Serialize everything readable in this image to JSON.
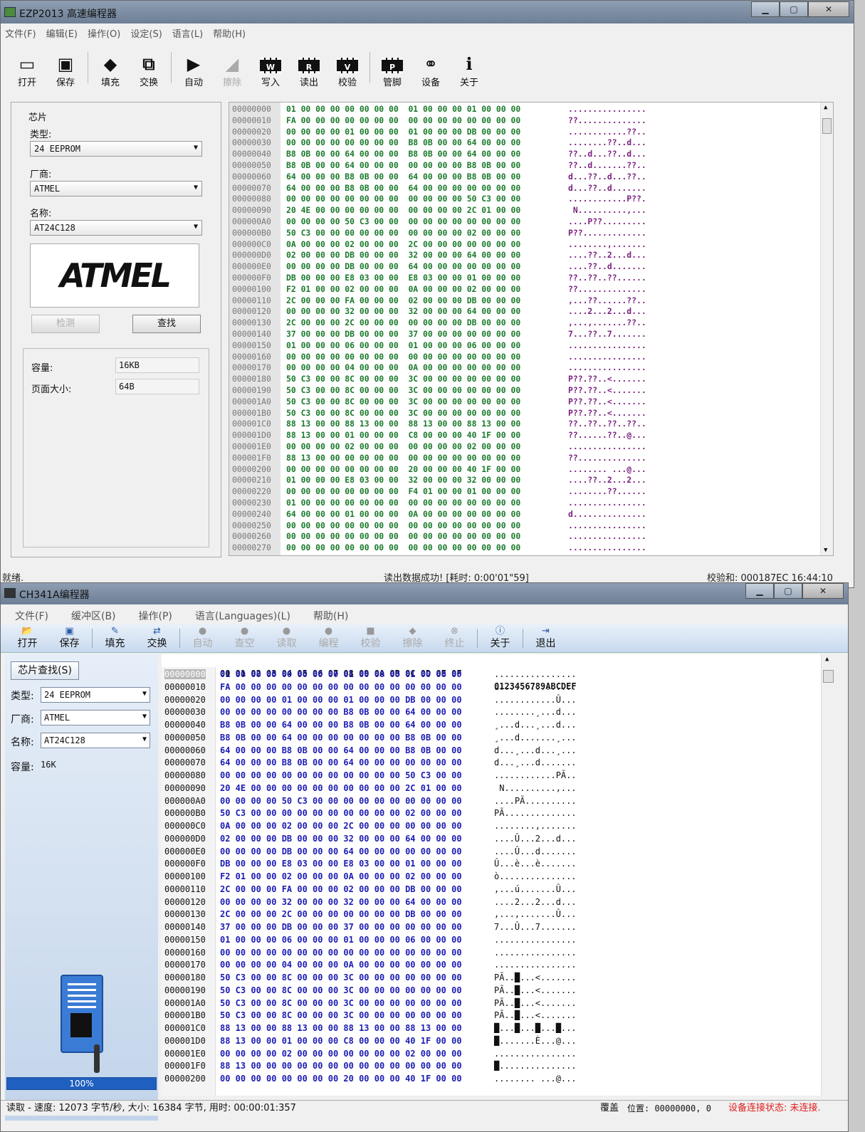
{
  "win1": {
    "title": "EZP2013 高速编程器",
    "menu": [
      "文件(F)",
      "编辑(E)",
      "操作(O)",
      "设定(S)",
      "语言(L)",
      "帮助(H)"
    ],
    "toolbar": [
      {
        "label": "打开",
        "icon": "open-icon",
        "enabled": true
      },
      {
        "label": "保存",
        "icon": "save-icon",
        "enabled": true
      },
      {
        "label": "填充",
        "icon": "fill-icon",
        "enabled": true
      },
      {
        "label": "交换",
        "icon": "swap-icon",
        "enabled": true
      },
      {
        "label": "自动",
        "icon": "auto-icon",
        "enabled": true
      },
      {
        "label": "擦除",
        "icon": "erase-icon",
        "enabled": false
      },
      {
        "label": "写入",
        "icon": "write-icon",
        "chip": "W",
        "enabled": true
      },
      {
        "label": "读出",
        "icon": "read-icon",
        "chip": "R",
        "enabled": true
      },
      {
        "label": "校验",
        "icon": "verify-icon",
        "chip": "V",
        "enabled": true
      },
      {
        "label": "管脚",
        "icon": "pin-icon",
        "chip": "P",
        "enabled": true
      },
      {
        "label": "设备",
        "icon": "device-icon",
        "enabled": true
      },
      {
        "label": "关于",
        "icon": "about-icon",
        "enabled": true
      }
    ],
    "chip": {
      "group_label": "芯片",
      "type_label": "类型:",
      "type_value": "24 EEPROM",
      "vendor_label": "厂商:",
      "vendor_value": "ATMEL",
      "name_label": "名称:",
      "name_value": "AT24C128",
      "logo_text": "ATMEL",
      "detect_button": "检测",
      "find_button": "查找",
      "capacity_label": "容量:",
      "capacity_value": "16KB",
      "page_label": "页面大小:",
      "page_value": "64B"
    },
    "hex_rows": [
      [
        "00000000",
        "01 00 00 00 00 00 00 00  01 00 00 00 01 00 00 00",
        "................"
      ],
      [
        "00000010",
        "FA 00 00 00 00 00 00 00  00 00 00 00 00 00 00 00",
        "??.............."
      ],
      [
        "00000020",
        "00 00 00 00 01 00 00 00  01 00 00 00 DB 00 00 00",
        "............??.."
      ],
      [
        "00000030",
        "00 00 00 00 00 00 00 00  B8 0B 00 00 64 00 00 00",
        "........??..d..."
      ],
      [
        "00000040",
        "B8 0B 00 00 64 00 00 00  B8 0B 00 00 64 00 00 00",
        "??..d...??..d..."
      ],
      [
        "00000050",
        "B8 0B 00 00 64 00 00 00  00 00 00 00 B8 0B 00 00",
        "??..d.......??.."
      ],
      [
        "00000060",
        "64 00 00 00 B8 0B 00 00  64 00 00 00 B8 0B 00 00",
        "d...??..d...??.."
      ],
      [
        "00000070",
        "64 00 00 00 B8 0B 00 00  64 00 00 00 00 00 00 00",
        "d...??..d......."
      ],
      [
        "00000080",
        "00 00 00 00 00 00 00 00  00 00 00 00 50 C3 00 00",
        "............P??."
      ],
      [
        "00000090",
        "20 4E 00 00 00 00 00 00  00 00 00 00 2C 01 00 00",
        " N..........,..."
      ],
      [
        "000000A0",
        "00 00 00 00 50 C3 00 00  00 00 00 00 00 00 00 00",
        "....P??........."
      ],
      [
        "000000B0",
        "50 C3 00 00 00 00 00 00  00 00 00 00 02 00 00 00",
        "P??............."
      ],
      [
        "000000C0",
        "0A 00 00 00 02 00 00 00  2C 00 00 00 00 00 00 00",
        "........,......."
      ],
      [
        "000000D0",
        "02 00 00 00 DB 00 00 00  32 00 00 00 64 00 00 00",
        "....??..2...d..."
      ],
      [
        "000000E0",
        "00 00 00 00 DB 00 00 00  64 00 00 00 00 00 00 00",
        "....??..d......."
      ],
      [
        "000000F0",
        "DB 00 00 00 E8 03 00 00  E8 03 00 00 01 00 00 00",
        "??..??..??......"
      ],
      [
        "00000100",
        "F2 01 00 00 02 00 00 00  0A 00 00 00 02 00 00 00",
        "??.............."
      ],
      [
        "00000110",
        "2C 00 00 00 FA 00 00 00  02 00 00 00 DB 00 00 00",
        ",...??......??.."
      ],
      [
        "00000120",
        "00 00 00 00 32 00 00 00  32 00 00 00 64 00 00 00",
        "....2...2...d..."
      ],
      [
        "00000130",
        "2C 00 00 00 2C 00 00 00  00 00 00 00 DB 00 00 00",
        ",...,.......??.."
      ],
      [
        "00000140",
        "37 00 00 00 DB 00 00 00  37 00 00 00 00 00 00 00",
        "7...??..7......."
      ],
      [
        "00000150",
        "01 00 00 00 06 00 00 00  01 00 00 00 06 00 00 00",
        "................"
      ],
      [
        "00000160",
        "00 00 00 00 00 00 00 00  00 00 00 00 00 00 00 00",
        "................"
      ],
      [
        "00000170",
        "00 00 00 00 04 00 00 00  0A 00 00 00 00 00 00 00",
        "................"
      ],
      [
        "00000180",
        "50 C3 00 00 8C 00 00 00  3C 00 00 00 00 00 00 00",
        "P??.??..<......."
      ],
      [
        "00000190",
        "50 C3 00 00 8C 00 00 00  3C 00 00 00 00 00 00 00",
        "P??.??..<......."
      ],
      [
        "000001A0",
        "50 C3 00 00 8C 00 00 00  3C 00 00 00 00 00 00 00",
        "P??.??..<......."
      ],
      [
        "000001B0",
        "50 C3 00 00 8C 00 00 00  3C 00 00 00 00 00 00 00",
        "P??.??..<......."
      ],
      [
        "000001C0",
        "88 13 00 00 88 13 00 00  88 13 00 00 88 13 00 00",
        "??..??..??..??.."
      ],
      [
        "000001D0",
        "88 13 00 00 01 00 00 00  C8 00 00 00 40 1F 00 00",
        "??......??..@..."
      ],
      [
        "000001E0",
        "00 00 00 00 02 00 00 00  00 00 00 00 02 00 00 00",
        "................"
      ],
      [
        "000001F0",
        "88 13 00 00 00 00 00 00  00 00 00 00 00 00 00 00",
        "??.............."
      ],
      [
        "00000200",
        "00 00 00 00 00 00 00 00  20 00 00 00 40 1F 00 00",
        "........ ...@..."
      ],
      [
        "00000210",
        "01 00 00 00 E8 03 00 00  32 00 00 00 32 00 00 00",
        "....??..2...2..."
      ],
      [
        "00000220",
        "00 00 00 00 00 00 00 00  F4 01 00 00 01 00 00 00",
        "........??......"
      ],
      [
        "00000230",
        "01 00 00 00 00 00 00 00  00 00 00 00 00 00 00 00",
        "................"
      ],
      [
        "00000240",
        "64 00 00 00 01 00 00 00  0A 00 00 00 00 00 00 00",
        "d..............."
      ],
      [
        "00000250",
        "00 00 00 00 00 00 00 00  00 00 00 00 00 00 00 00",
        "................"
      ],
      [
        "00000260",
        "00 00 00 00 00 00 00 00  00 00 00 00 00 00 00 00",
        "................"
      ],
      [
        "00000270",
        "00 00 00 00 00 00 00 00  00 00 00 00 00 00 00 00",
        "................"
      ]
    ],
    "status": {
      "left": "就绪.",
      "middle": "读出数据成功! [耗时: 0:00'01\"59]",
      "right": "校验和: 000187EC 16:44:10"
    }
  },
  "win2": {
    "title": "CH341A编程器",
    "menu": [
      "文件(F)",
      "缓冲区(B)",
      "操作(P)",
      "语言(Languages)(L)",
      "帮助(H)"
    ],
    "toolbar": [
      {
        "label": "打开",
        "icon": "open-icon",
        "enabled": true
      },
      {
        "label": "保存",
        "icon": "save-icon",
        "enabled": true
      },
      {
        "label": "填充",
        "icon": "fill-icon",
        "enabled": true
      },
      {
        "label": "交换",
        "icon": "swap-icon",
        "enabled": true
      },
      {
        "label": "自动",
        "icon": "auto-icon",
        "enabled": false
      },
      {
        "label": "查空",
        "icon": "blank-check-icon",
        "enabled": false
      },
      {
        "label": "读取",
        "icon": "read-icon",
        "enabled": false
      },
      {
        "label": "编程",
        "icon": "program-icon",
        "enabled": false
      },
      {
        "label": "校验",
        "icon": "verify-icon",
        "enabled": false
      },
      {
        "label": "擦除",
        "icon": "erase-icon",
        "enabled": false
      },
      {
        "label": "终止",
        "icon": "stop-icon",
        "enabled": false
      },
      {
        "label": "关于",
        "icon": "about-icon",
        "enabled": true
      },
      {
        "label": "退出",
        "icon": "exit-icon",
        "enabled": true
      }
    ],
    "chip": {
      "find_button": "芯片查找(S)",
      "type_label": "类型:",
      "type_value": "24 EEPROM",
      "vendor_label": "厂商:",
      "vendor_value": "ATMEL",
      "name_label": "名称:",
      "name_value": "AT24C128",
      "capacity_label": "容量:",
      "capacity_value": "16K",
      "progress_text": "100%",
      "progress": 1.0
    },
    "hex_header": "00 01 02 03 04 05 06 07 08 09 0A 0B 0C 0D 0E 0F",
    "ascii_header": "0123456789ABCDEF",
    "hex_rows": [
      [
        "00000000",
        "01 00 00 00 00 00 00 00 01 00 00 00 01 00 00 00",
        "................"
      ],
      [
        "00000010",
        "FA 00 00 00 00 00 00 00 00 00 00 00 00 00 00 00",
        "ú..............."
      ],
      [
        "00000020",
        "00 00 00 00 01 00 00 00 01 00 00 00 DB 00 00 00",
        "............Û..."
      ],
      [
        "00000030",
        "00 00 00 00 00 00 00 00 B8 0B 00 00 64 00 00 00",
        "........¸...d..."
      ],
      [
        "00000040",
        "B8 0B 00 00 64 00 00 00 B8 0B 00 00 64 00 00 00",
        "¸...d...¸...d..."
      ],
      [
        "00000050",
        "B8 0B 00 00 64 00 00 00 00 00 00 00 B8 0B 00 00",
        "¸...d.......¸..."
      ],
      [
        "00000060",
        "64 00 00 00 B8 0B 00 00 64 00 00 00 B8 0B 00 00",
        "d...¸...d...¸..."
      ],
      [
        "00000070",
        "64 00 00 00 B8 0B 00 00 64 00 00 00 00 00 00 00",
        "d...¸...d......."
      ],
      [
        "00000080",
        "00 00 00 00 00 00 00 00 00 00 00 00 50 C3 00 00",
        "............PÃ.."
      ],
      [
        "00000090",
        "20 4E 00 00 00 00 00 00 00 00 00 00 2C 01 00 00",
        " N..........,..."
      ],
      [
        "000000A0",
        "00 00 00 00 50 C3 00 00 00 00 00 00 00 00 00 00",
        "....PÃ.........."
      ],
      [
        "000000B0",
        "50 C3 00 00 00 00 00 00 00 00 00 00 02 00 00 00",
        "PÃ.............."
      ],
      [
        "000000C0",
        "0A 00 00 00 02 00 00 00 2C 00 00 00 00 00 00 00",
        "........,......."
      ],
      [
        "000000D0",
        "02 00 00 00 DB 00 00 00 32 00 00 00 64 00 00 00",
        "....Û...2...d..."
      ],
      [
        "000000E0",
        "00 00 00 00 DB 00 00 00 64 00 00 00 00 00 00 00",
        "....Û...d......."
      ],
      [
        "000000F0",
        "DB 00 00 00 E8 03 00 00 E8 03 00 00 01 00 00 00",
        "Û...è...è......."
      ],
      [
        "00000100",
        "F2 01 00 00 02 00 00 00 0A 00 00 00 02 00 00 00",
        "ò..............."
      ],
      [
        "00000110",
        "2C 00 00 00 FA 00 00 00 02 00 00 00 DB 00 00 00",
        ",...ú.......Û..."
      ],
      [
        "00000120",
        "00 00 00 00 32 00 00 00 32 00 00 00 64 00 00 00",
        "....2...2...d..."
      ],
      [
        "00000130",
        "2C 00 00 00 2C 00 00 00 00 00 00 00 DB 00 00 00",
        ",...,.......Û..."
      ],
      [
        "00000140",
        "37 00 00 00 DB 00 00 00 37 00 00 00 00 00 00 00",
        "7...Û...7......."
      ],
      [
        "00000150",
        "01 00 00 00 06 00 00 00 01 00 00 00 06 00 00 00",
        "................"
      ],
      [
        "00000160",
        "00 00 00 00 00 00 00 00 00 00 00 00 00 00 00 00",
        "................"
      ],
      [
        "00000170",
        "00 00 00 00 04 00 00 00 0A 00 00 00 00 00 00 00",
        "................"
      ],
      [
        "00000180",
        "50 C3 00 00 8C 00 00 00 3C 00 00 00 00 00 00 00",
        "PÃ..█...<......."
      ],
      [
        "00000190",
        "50 C3 00 00 8C 00 00 00 3C 00 00 00 00 00 00 00",
        "PÃ..█...<......."
      ],
      [
        "000001A0",
        "50 C3 00 00 8C 00 00 00 3C 00 00 00 00 00 00 00",
        "PÃ..█...<......."
      ],
      [
        "000001B0",
        "50 C3 00 00 8C 00 00 00 3C 00 00 00 00 00 00 00",
        "PÃ..█...<......."
      ],
      [
        "000001C0",
        "88 13 00 00 88 13 00 00 88 13 00 00 88 13 00 00",
        "█...█...█...█..."
      ],
      [
        "000001D0",
        "88 13 00 00 01 00 00 00 C8 00 00 00 40 1F 00 00",
        "█.......È...@..."
      ],
      [
        "000001E0",
        "00 00 00 00 02 00 00 00 00 00 00 00 02 00 00 00",
        "................"
      ],
      [
        "000001F0",
        "88 13 00 00 00 00 00 00 00 00 00 00 00 00 00 00",
        "█..............."
      ],
      [
        "00000200",
        "00 00 00 00 00 00 00 00 20 00 00 00 40 1F 00 00",
        "........ ...@..."
      ]
    ],
    "status": {
      "left": "读取 - 速度: 12073 字节/秒, 大小: 16384 字节, 用时: 00:00:01:357",
      "mode": "覆盖",
      "position": "位置: 00000000, 0",
      "connection": "设备连接状态: 未连接."
    }
  }
}
